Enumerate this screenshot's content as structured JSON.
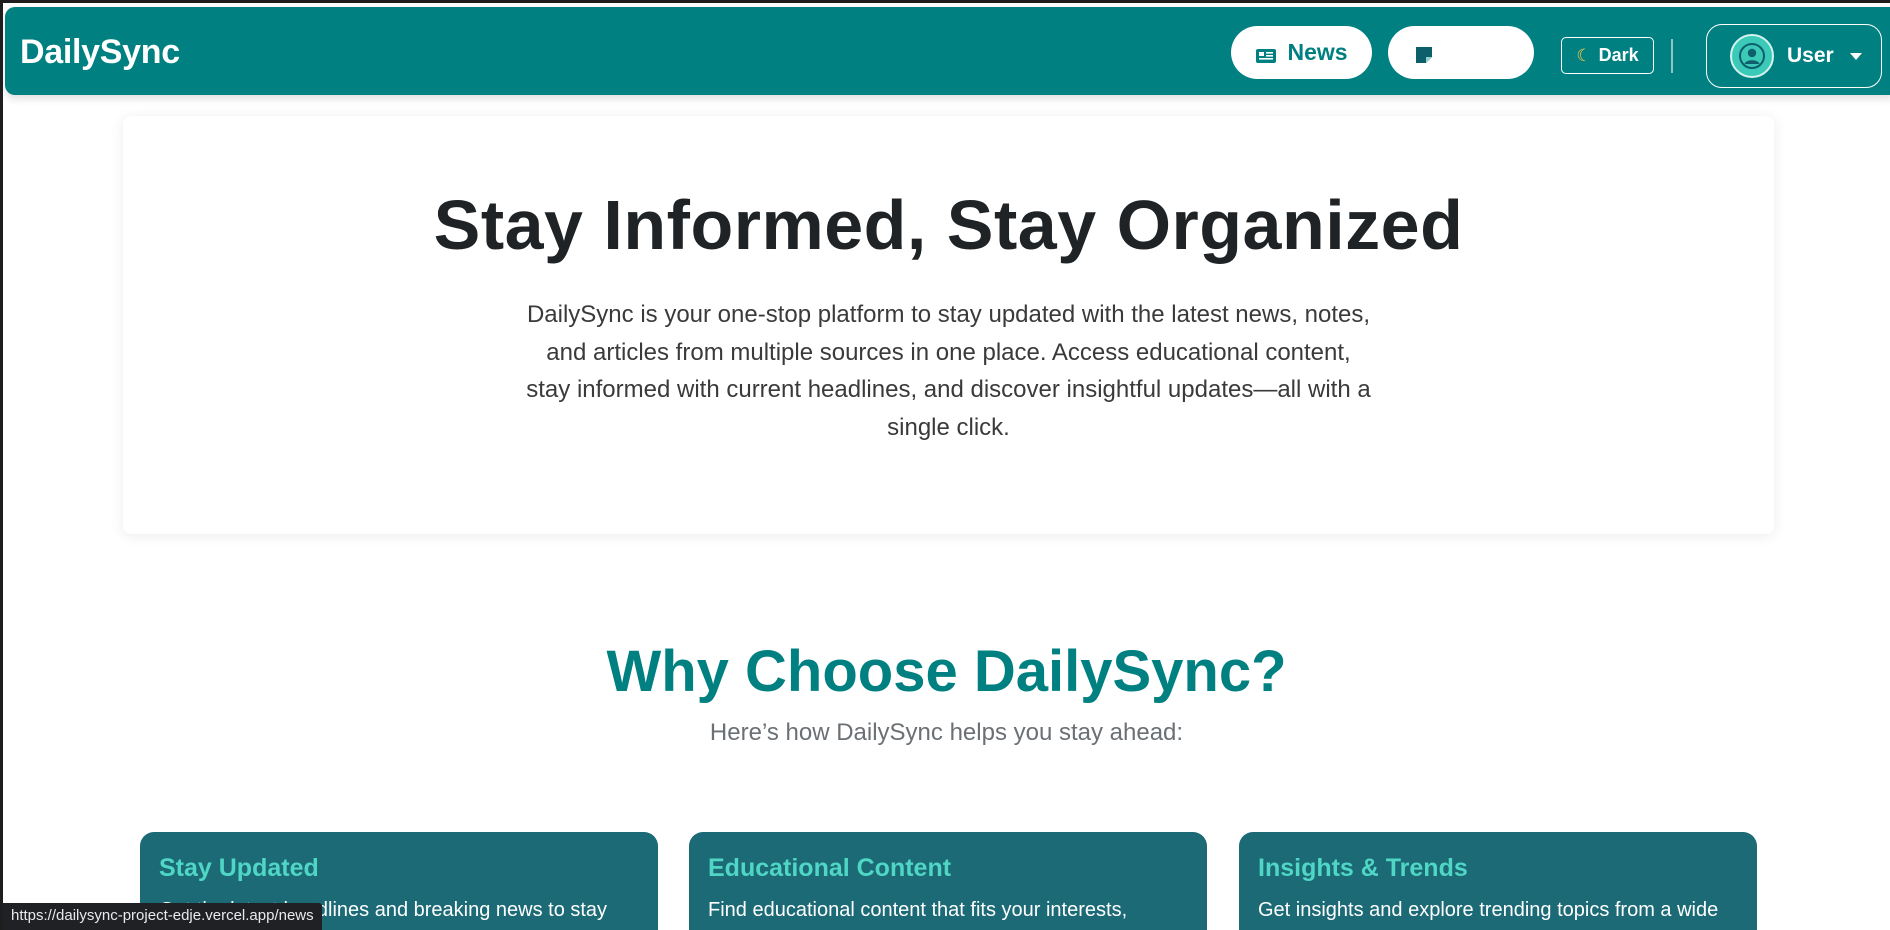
{
  "navbar": {
    "brand": "DailySync",
    "news_label": "News",
    "notes_label": "",
    "theme_label": "Dark",
    "user_label": "User"
  },
  "hero": {
    "title": "Stay Informed, Stay Organized",
    "description": "DailySync is your one-stop platform to stay updated with the latest news, notes, and articles from multiple sources in one place. Access educational content, stay informed with current headlines, and discover insightful updates—all with a single click."
  },
  "why": {
    "title": "Why Choose DailySync?",
    "subtitle": "Here’s how DailySync helps you stay ahead:"
  },
  "features": [
    {
      "title": "Stay Updated",
      "text": "Get the latest headlines and breaking news to stay"
    },
    {
      "title": "Educational Content",
      "text": "Find educational content that fits your interests,"
    },
    {
      "title": "Insights & Trends",
      "text": "Get insights and explore trending topics from a wide"
    }
  ],
  "status_bar": {
    "url": "https://dailysync-project-edje.vercel.app/news"
  },
  "colors": {
    "brand_teal": "#008080",
    "card_bg": "#1b6a76",
    "card_title": "#4fd6c4",
    "moon": "#ffc94a"
  },
  "icons": [
    "newspaper-icon",
    "note-icon",
    "moon-icon",
    "user-avatar-icon",
    "chevron-down-icon"
  ]
}
